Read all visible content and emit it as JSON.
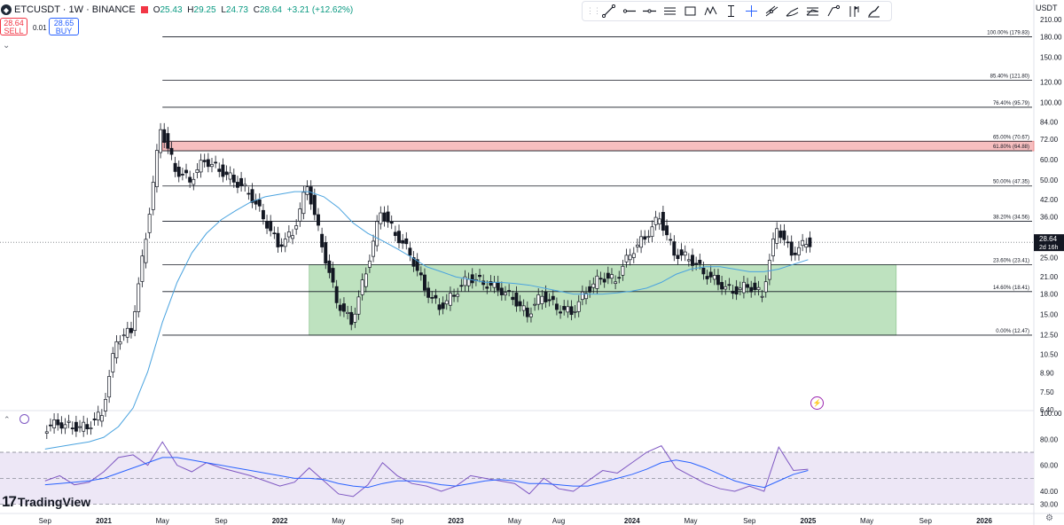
{
  "header": {
    "symbol": "ETCUSDT · 1W · BINANCE",
    "open_label": "O",
    "open": "25.43",
    "high_label": "H",
    "high": "29.25",
    "low_label": "L",
    "low": "24.73",
    "close_label": "C",
    "close": "28.64",
    "change": "+3.21 (+12.62%)"
  },
  "trade": {
    "sell_price": "28.64",
    "sell_label": "SELL",
    "spread": "0.01",
    "buy_price": "28.65",
    "buy_label": "BUY"
  },
  "toolbar": {
    "tools": [
      "trend-line-icon",
      "horizontal-ray-icon",
      "horizontal-line-icon",
      "parallel-channel-icon",
      "rectangle-icon",
      "pattern-icon",
      "vertical-line-icon",
      "crosshair-icon",
      "regression-icon",
      "fib-icon",
      "long-position-icon",
      "path-icon",
      "pitchfork-icon",
      "brush-icon"
    ]
  },
  "price_axis": {
    "unit": "USDT",
    "ticks": [
      "210.00",
      "180.00",
      "150.00",
      "120.00",
      "100.00",
      "84.00",
      "72.00",
      "60.00",
      "50.00",
      "42.00",
      "36.00",
      "30.00",
      "25.00",
      "21.00",
      "18.00",
      "15.00",
      "12.50",
      "10.50",
      "8.90",
      "7.50",
      "6.40"
    ],
    "current_price": "28.64",
    "countdown": "2d 16h"
  },
  "rsi_axis": {
    "ticks": [
      "100.00",
      "80.00",
      "60.00",
      "40.00",
      "30.00"
    ]
  },
  "time_axis": {
    "labels": [
      "Sep",
      "2021",
      "May",
      "Sep",
      "2022",
      "May",
      "Sep",
      "2023",
      "May",
      "Aug",
      "2024",
      "May",
      "Sep",
      "2025",
      "May",
      "Sep",
      "2026"
    ]
  },
  "branding": {
    "name": "TradingView",
    "mark": "17"
  },
  "colors": {
    "up": "#089981",
    "candle_body": "#131722",
    "ma": "#4aa3df",
    "rsi": "#7e57c2",
    "rsi_ma": "#2962ff",
    "rsi_band": "#ede7f6",
    "green_zone": "#b7dfb9",
    "red_zone": "#f7b7b9"
  },
  "chart_data": [
    {
      "type": "candlestick",
      "title": "ETCUSDT · 1W · BINANCE",
      "ylim": [
        6.4,
        210
      ],
      "yscale": "log",
      "fib_levels": [
        {
          "label": "100.00% (179.83)",
          "value": 179.83
        },
        {
          "label": "85.40% (121.80)",
          "value": 121.8
        },
        {
          "label": "76.40% (95.79)",
          "value": 95.79
        },
        {
          "label": "65.00% (70.67)",
          "value": 70.67
        },
        {
          "label": "61.80% (64.88)",
          "value": 64.88
        },
        {
          "label": "50.00% (47.35)",
          "value": 47.35
        },
        {
          "label": "38.20% (34.56)",
          "value": 34.56
        },
        {
          "label": "23.60% (23.41)",
          "value": 23.41
        },
        {
          "label": "14.60% (18.41)",
          "value": 18.41
        },
        {
          "label": "0.00% (12.47)",
          "value": 12.47
        }
      ],
      "zones": [
        {
          "name": "support",
          "from": "2022-03",
          "to": "2025-07",
          "low": 12.47,
          "high": 23.41
        },
        {
          "name": "resistance",
          "from": "2021-05",
          "to": "2026-06",
          "low": 64.88,
          "high": 70.67
        }
      ],
      "x": [
        "2020-09",
        "2020-10",
        "2020-11",
        "2020-12",
        "2021-01",
        "2021-02",
        "2021-03",
        "2021-04",
        "2021-05",
        "2021-06",
        "2021-07",
        "2021-08",
        "2021-09",
        "2021-10",
        "2021-11",
        "2021-12",
        "2022-01",
        "2022-02",
        "2022-03",
        "2022-04",
        "2022-05",
        "2022-06",
        "2022-07",
        "2022-08",
        "2022-09",
        "2022-10",
        "2022-11",
        "2022-12",
        "2023-01",
        "2023-02",
        "2023-03",
        "2023-04",
        "2023-05",
        "2023-06",
        "2023-07",
        "2023-08",
        "2023-09",
        "2023-10",
        "2023-11",
        "2023-12",
        "2024-01",
        "2024-02",
        "2024-03",
        "2024-04",
        "2024-05",
        "2024-06",
        "2024-07",
        "2024-08",
        "2024-09",
        "2024-10",
        "2024-11",
        "2024-12",
        "2025-01"
      ],
      "series": [
        {
          "name": "Price",
          "values": [
            5.4,
            5.7,
            5.5,
            5.5,
            6.2,
            12.0,
            13.0,
            30.0,
            80.0,
            55.0,
            50.0,
            60.0,
            55.0,
            50.0,
            45.0,
            36.0,
            28.0,
            31.0,
            48.0,
            28.0,
            17.0,
            14.0,
            22.0,
            38.0,
            31.0,
            26.0,
            19.0,
            16.0,
            18.0,
            21.0,
            20.0,
            19.0,
            17.5,
            15.0,
            18.0,
            16.0,
            15.3,
            18.5,
            21.0,
            20.5,
            26.0,
            30.0,
            36.0,
            26.0,
            25.0,
            22.0,
            20.0,
            18.5,
            19.5,
            18.0,
            33.0,
            26.0,
            28.64
          ]
        },
        {
          "name": "MA",
          "values": [
            4.5,
            4.6,
            4.7,
            4.8,
            5.0,
            5.5,
            6.5,
            9.0,
            14.0,
            20.0,
            26.0,
            31.0,
            35.0,
            38.0,
            41.0,
            43.0,
            44.0,
            45.0,
            45.0,
            43.0,
            39.0,
            34.0,
            31.0,
            29.0,
            27.0,
            25.0,
            23.0,
            22.0,
            21.0,
            20.5,
            20.0,
            20.0,
            19.8,
            19.5,
            19.0,
            18.5,
            18.0,
            18.0,
            18.0,
            18.2,
            18.5,
            19.0,
            20.0,
            21.5,
            22.5,
            23.0,
            23.0,
            22.5,
            22.0,
            22.0,
            22.5,
            23.5,
            24.5
          ]
        }
      ]
    },
    {
      "type": "line",
      "title": "",
      "ylim": [
        25,
        100
      ],
      "bands": [
        30,
        50,
        70
      ],
      "x": [
        "2020-09",
        "2020-10",
        "2020-11",
        "2020-12",
        "2021-01",
        "2021-02",
        "2021-03",
        "2021-04",
        "2021-05",
        "2021-06",
        "2021-07",
        "2021-08",
        "2021-09",
        "2021-10",
        "2021-11",
        "2021-12",
        "2022-01",
        "2022-02",
        "2022-03",
        "2022-04",
        "2022-05",
        "2022-06",
        "2022-07",
        "2022-08",
        "2022-09",
        "2022-10",
        "2022-11",
        "2022-12",
        "2023-01",
        "2023-02",
        "2023-03",
        "2023-04",
        "2023-05",
        "2023-06",
        "2023-07",
        "2023-08",
        "2023-09",
        "2023-10",
        "2023-11",
        "2023-12",
        "2024-01",
        "2024-02",
        "2024-03",
        "2024-04",
        "2024-05",
        "2024-06",
        "2024-07",
        "2024-08",
        "2024-09",
        "2024-10",
        "2024-11",
        "2024-12",
        "2025-01"
      ],
      "series": [
        {
          "name": "RSI",
          "values": [
            48,
            52,
            45,
            47,
            55,
            66,
            68,
            60,
            78,
            60,
            55,
            62,
            58,
            55,
            52,
            48,
            44,
            47,
            58,
            48,
            38,
            36,
            45,
            62,
            52,
            46,
            44,
            40,
            44,
            52,
            50,
            48,
            46,
            38,
            50,
            42,
            40,
            48,
            56,
            54,
            62,
            70,
            75,
            58,
            52,
            46,
            42,
            40,
            44,
            40,
            74,
            56,
            57
          ]
        },
        {
          "name": "RSI MA",
          "values": [
            45,
            46,
            47,
            48,
            50,
            54,
            58,
            62,
            66,
            66,
            64,
            62,
            60,
            58,
            56,
            54,
            52,
            50,
            50,
            49,
            46,
            44,
            43,
            46,
            48,
            48,
            47,
            45,
            44,
            46,
            48,
            49,
            48,
            46,
            46,
            45,
            44,
            44,
            47,
            50,
            53,
            57,
            62,
            64,
            62,
            58,
            53,
            48,
            45,
            43,
            48,
            53,
            56
          ]
        }
      ]
    }
  ]
}
